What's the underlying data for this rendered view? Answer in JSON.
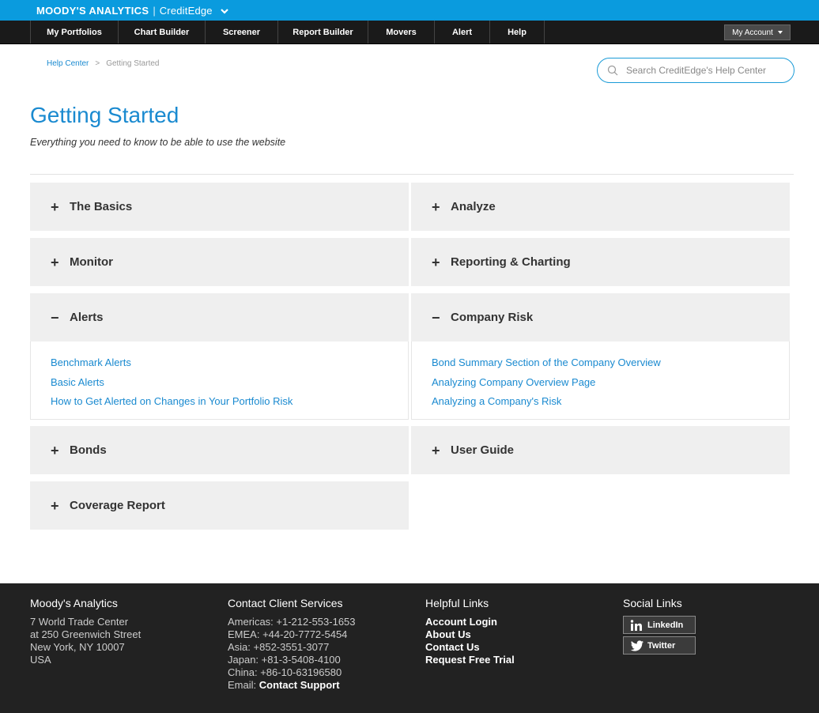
{
  "brand": {
    "main": "MOODY'S ANALYTICS",
    "sub": "CreditEdge"
  },
  "nav": {
    "items": [
      {
        "label": "My Portfolios"
      },
      {
        "label": "Chart Builder"
      },
      {
        "label": "Screener"
      },
      {
        "label": "Report Builder"
      },
      {
        "label": "Movers"
      },
      {
        "label": "Alert"
      },
      {
        "label": "Help"
      }
    ],
    "account_label": "My Account"
  },
  "breadcrumb": {
    "home": "Help Center",
    "sep": ">",
    "current": "Getting Started"
  },
  "search": {
    "placeholder": "Search CreditEdge's Help Center"
  },
  "page": {
    "title": "Getting Started",
    "subtitle": "Everything you need to know to be able to use the website"
  },
  "sections": {
    "basics": {
      "sign": "+",
      "title": "The Basics"
    },
    "analyze": {
      "sign": "+",
      "title": "Analyze"
    },
    "monitor": {
      "sign": "+",
      "title": "Monitor"
    },
    "reporting": {
      "sign": "+",
      "title": "Reporting & Charting"
    },
    "alerts": {
      "sign": "−",
      "title": "Alerts",
      "links": [
        "Benchmark Alerts",
        "Basic Alerts",
        "How to Get Alerted on Changes in Your Portfolio Risk"
      ]
    },
    "company_risk": {
      "sign": "−",
      "title": "Company Risk",
      "links": [
        "Bond Summary Section of the Company Overview",
        "Analyzing Company Overview Page",
        "Analyzing a Company's Risk"
      ]
    },
    "bonds": {
      "sign": "+",
      "title": "Bonds"
    },
    "user_guide": {
      "sign": "+",
      "title": "User Guide"
    },
    "coverage": {
      "sign": "+",
      "title": "Coverage Report"
    }
  },
  "footer": {
    "company": {
      "heading": "Moody's Analytics",
      "lines": [
        "7 World Trade Center",
        "at 250 Greenwich Street",
        "New York, NY 10007",
        "USA"
      ]
    },
    "contact": {
      "heading": "Contact Client Services",
      "lines": [
        "Americas: +1-212-553-1653",
        "EMEA: +44-20-7772-5454",
        "Asia: +852-3551-3077",
        "Japan: +81-3-5408-4100",
        "China: +86-10-63196580"
      ],
      "email_label": "Email:",
      "email_link": "Contact Support"
    },
    "helpful": {
      "heading": "Helpful Links",
      "links": [
        "Account Login",
        "About Us",
        "Contact Us",
        "Request Free Trial"
      ]
    },
    "social": {
      "heading": "Social Links",
      "linkedin": "LinkedIn",
      "twitter": "Twitter"
    }
  },
  "colors": {
    "brand_blue": "#0a9bde",
    "link_blue": "#1a8ad0",
    "nav_bg": "#1a1a1a",
    "footer_bg": "#222222",
    "panel_bg": "#efefef"
  }
}
